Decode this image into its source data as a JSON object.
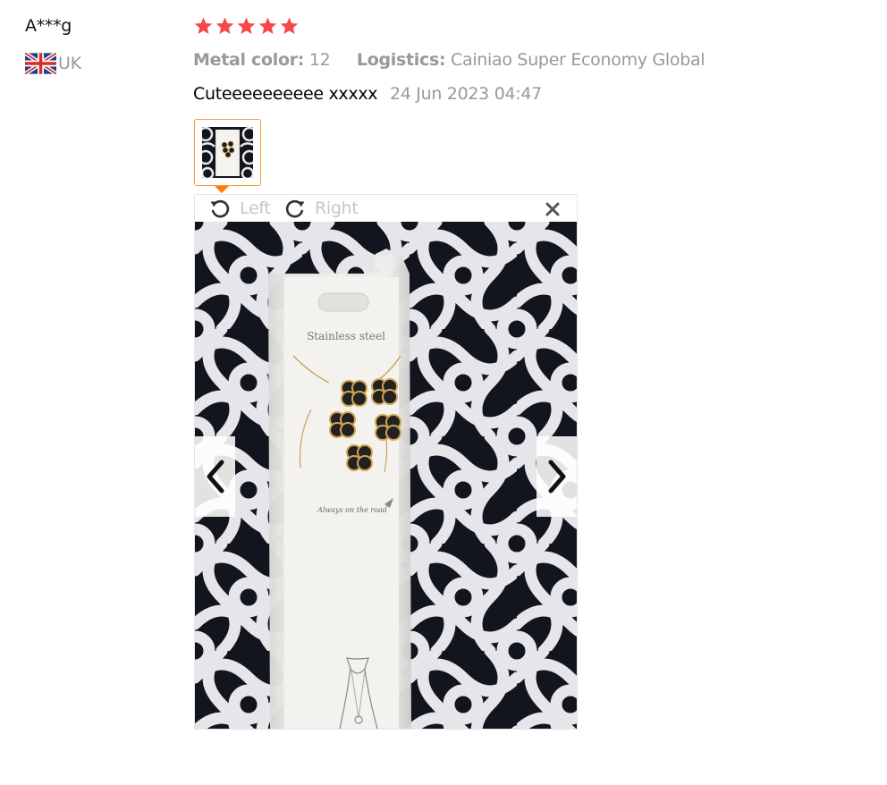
{
  "reviewer": {
    "name": "A***g",
    "country_code": "UK",
    "flag_icon": "uk-flag-icon"
  },
  "rating": {
    "stars": 5,
    "max": 5,
    "star_color": "#f5484b"
  },
  "sku": {
    "metal_color_label": "Metal color:",
    "metal_color_value": "12",
    "logistics_label": "Logistics:",
    "logistics_value": "Cainiao Super Economy Global"
  },
  "review": {
    "text": "Cuteeeeeeeeee xxxxx",
    "date": "24 Jun 2023 04:47"
  },
  "viewer": {
    "rotate_left_label": "Left",
    "rotate_right_label": "Right",
    "rotate_left_icon": "rotate-left-icon",
    "rotate_right_icon": "rotate-right-icon",
    "close_icon": "close-icon",
    "prev_icon": "chevron-left-icon",
    "next_icon": "chevron-right-icon",
    "photo_printed_text": {
      "card_title": "Stainless steel",
      "card_tagline": "Always on the road"
    }
  },
  "colors": {
    "accent_border": "#ff9a30",
    "pointer": "#ff7a00",
    "muted_text": "#999999"
  }
}
